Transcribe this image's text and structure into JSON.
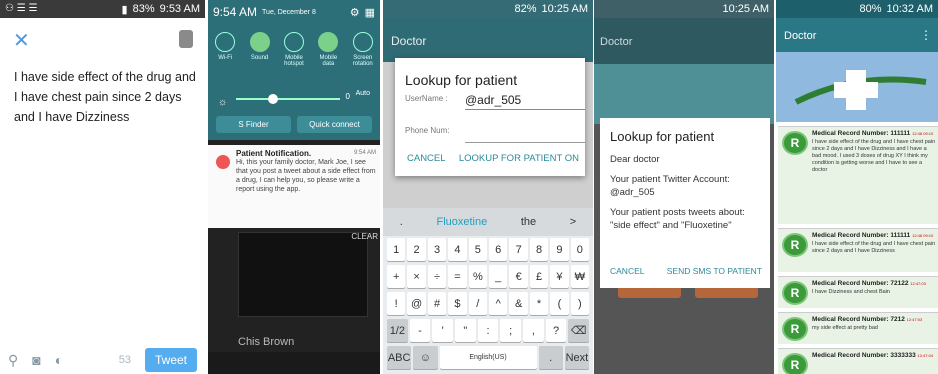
{
  "panel1": {
    "status": "9:53 AM",
    "battery": "83%",
    "tweet_text": "I have side effect of the drug and I have chest pain since 2 days and I have Dizziness",
    "char_count": "53",
    "tweet_button": "Tweet"
  },
  "panel2": {
    "time": "9:54 AM",
    "date": "Tue, December 8",
    "toggles": [
      "Wi-Fi",
      "Sound",
      "Mobile hotspot",
      "Mobile data",
      "Screen rotation"
    ],
    "brightness_value": "0",
    "auto_label": "Auto",
    "s_finder": "S Finder",
    "quick_connect": "Quick connect",
    "notif_title": "Patient Notification.",
    "notif_time": "9:54 AM",
    "notif_body": "Hi, this your family doctor, Mark Joe, I see that you post a tweet about a side effect from a drug, I can help you, so please write a report using the app.",
    "clear": "CLEAR",
    "artist": "Chis Brown"
  },
  "panel3": {
    "status": "10:25 AM",
    "battery": "82%",
    "app_title": "Doctor",
    "dialog_title": "Lookup for patient",
    "username_label": "UserName :",
    "username_value": "@adr_505",
    "phone_label": "Phone Num:",
    "cancel": "CANCEL",
    "lookup": "LOOKUP FOR PATIENT ON",
    "suggestions": [
      ".",
      "Fluoxetine",
      "the",
      ">"
    ],
    "row1": [
      "1",
      "2",
      "3",
      "4",
      "5",
      "6",
      "7",
      "8",
      "9",
      "0"
    ],
    "row2": [
      "+",
      "×",
      "÷",
      "=",
      "%",
      "_",
      "€",
      "£",
      "¥",
      "₩"
    ],
    "row3": [
      "!",
      "@",
      "#",
      "$",
      "/",
      "^",
      "&",
      "*",
      "(",
      ")"
    ],
    "row4": [
      "1/2",
      "-",
      "'",
      "\"",
      ":",
      ";",
      ",",
      "?",
      "⌫"
    ],
    "row5": [
      "ABC",
      "☺",
      "English(US)",
      ".",
      "Next"
    ]
  },
  "panel4": {
    "status": "10:25 AM",
    "app_title": "Doctor",
    "dialog_title": "Lookup for patient",
    "greeting": "Dear doctor",
    "account_text": "Your patient Twitter Account: @adr_505",
    "tweets_text": "Your patient posts tweets about: \"side effect\" and \"Fluoxetine\"",
    "cancel": "CANCEL",
    "send": "SEND SMS TO PATIENT"
  },
  "panel5": {
    "status": "10:32 AM",
    "battery": "80%",
    "app_title": "Doctor",
    "records": [
      {
        "title": "Medical Record Number: 111111",
        "time": "12:48 09:10",
        "body": "I have side effect of the drug and I have chest pain since 2 days and I have Dizziness and I have a bad mood. I used 3 doses of drug XY I think my condition is getting worse and I have to see a doctor"
      },
      {
        "title": "Medical Record Number: 111111",
        "time": "12:48 09:10",
        "body": "I have side effect of the drug and I have chest pain since 2 days and I have Dizziness"
      },
      {
        "title": "Medical Record Number: 72122",
        "time": "12:47:03",
        "body": "I have Dizziness and chest Bain"
      },
      {
        "title": "Medical Record Number: 7212",
        "time": "12:47:03",
        "body": "my side effect at pretty bad"
      },
      {
        "title": "Medical Record Number: 3333333",
        "time": "12:47:04",
        "body": ""
      }
    ]
  }
}
